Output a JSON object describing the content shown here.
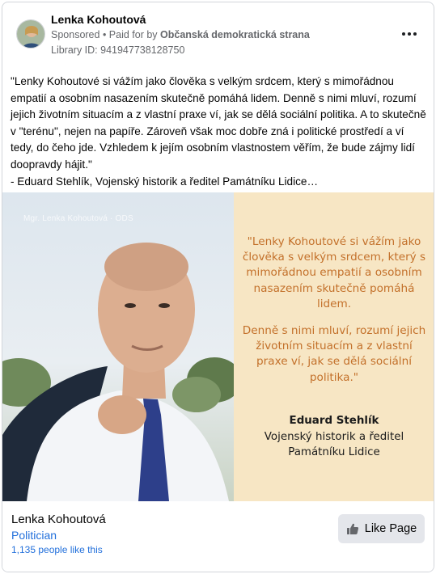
{
  "header": {
    "page_name": "Lenka Kohoutová",
    "sponsored": "Sponsored",
    "paid_for_prefix": " • Paid for by ",
    "paid_for_by": "Občanská demokratická strana",
    "library_id": "Library ID: 941947738128750",
    "more_icon": "more-horizontal-icon"
  },
  "ad_text": "\"Lenky Kohoutové si vážím jako člověka s velkým srdcem, který s mimořádnou empatií a osobním nasazením skutečně pomáhá lidem. Denně s nimi mluví, rozumí jejich životním situacím a z vlastní praxe ví, jak se dělá sociální politika. A to skutečně v \"terénu\", nejen na papíře. Zároveň však moc dobře zná i politické prostředí a ví tedy, do čeho jde. Vzhledem k jejím osobním vlastnostem věřím, že bude zájmy lidí doopravdy hájit.\"\n- Eduard Stehlík, Vojenský historik a ředitel Památníku Lidice…",
  "creative": {
    "photo_caption": "Mgr. Lenka Kohoutová · ODS",
    "quote_paragraph_1": "\"Lenky Kohoutové si vážím jako člověka s velkým srdcem, který s mimořádnou empatií a osobním nasazením skutečně pomáhá lidem.",
    "quote_paragraph_2": "Denně s nimi mluví, rozumí jejich životním situacím a z vlastní praxe ví, jak se dělá sociální politika.\"",
    "author_name": "Eduard Stehlík",
    "author_title": "Vojenský historik a ředitel Památníku Lidice",
    "colors": {
      "panel_background": "#f7e6c4",
      "quote_text": "#c3702a"
    }
  },
  "footer": {
    "page_name": "Lenka Kohoutová",
    "category": "Politician",
    "likes": "1,135 people like this",
    "like_button_label": "Like Page",
    "like_icon": "thumbs-up-icon"
  }
}
